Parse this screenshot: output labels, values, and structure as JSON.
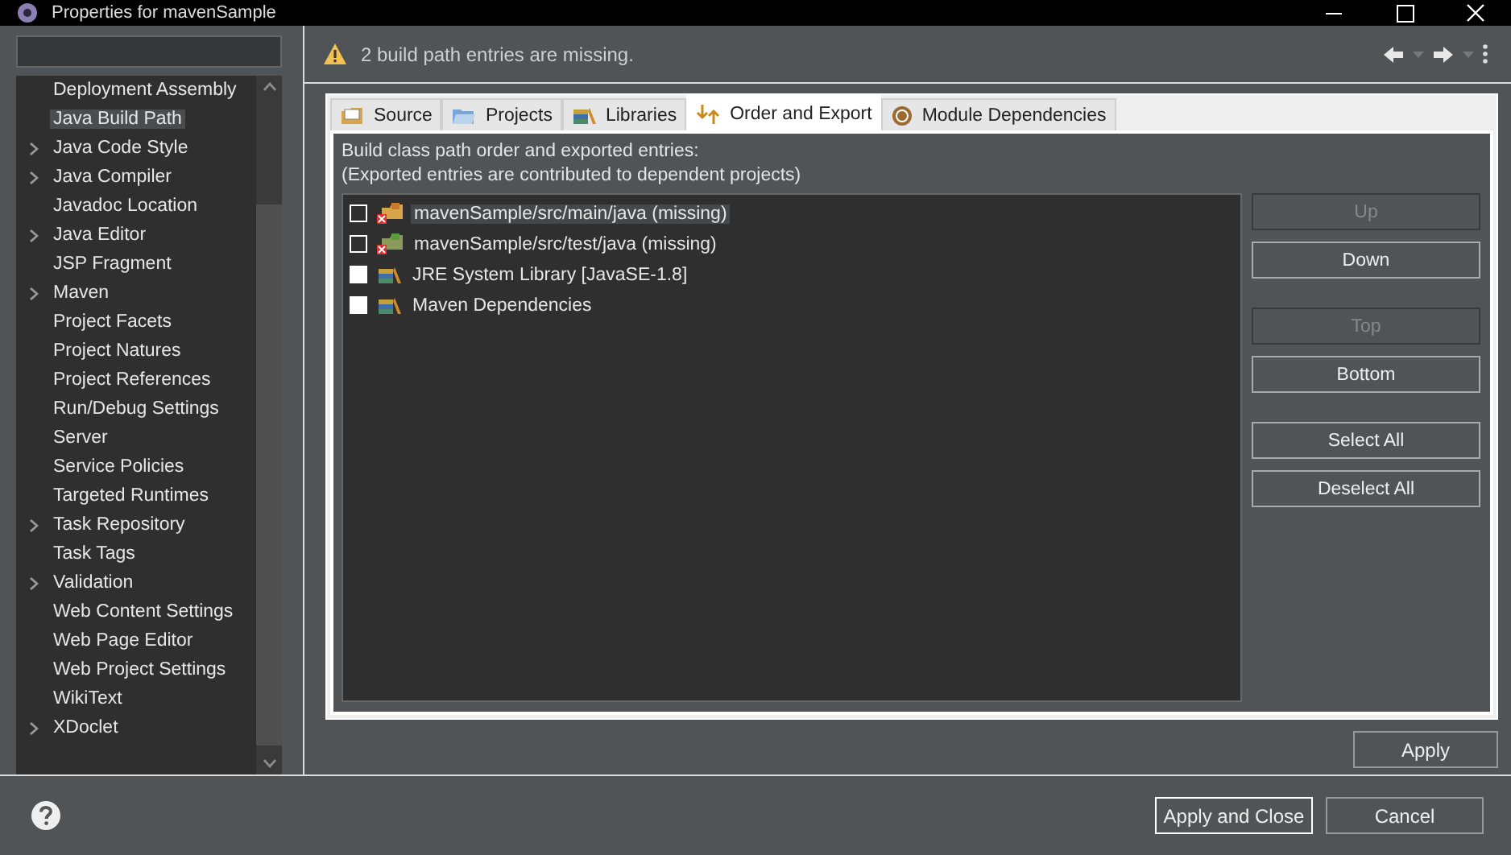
{
  "window": {
    "title": "Properties for mavenSample"
  },
  "sidebar": {
    "items": [
      {
        "label": "Deployment Assembly",
        "expandable": false,
        "selected": false
      },
      {
        "label": "Java Build Path",
        "expandable": false,
        "selected": true
      },
      {
        "label": "Java Code Style",
        "expandable": true,
        "selected": false
      },
      {
        "label": "Java Compiler",
        "expandable": true,
        "selected": false
      },
      {
        "label": "Javadoc Location",
        "expandable": false,
        "selected": false
      },
      {
        "label": "Java Editor",
        "expandable": true,
        "selected": false
      },
      {
        "label": "JSP Fragment",
        "expandable": false,
        "selected": false
      },
      {
        "label": "Maven",
        "expandable": true,
        "selected": false
      },
      {
        "label": "Project Facets",
        "expandable": false,
        "selected": false
      },
      {
        "label": "Project Natures",
        "expandable": false,
        "selected": false
      },
      {
        "label": "Project References",
        "expandable": false,
        "selected": false
      },
      {
        "label": "Run/Debug Settings",
        "expandable": false,
        "selected": false
      },
      {
        "label": "Server",
        "expandable": false,
        "selected": false
      },
      {
        "label": "Service Policies",
        "expandable": false,
        "selected": false
      },
      {
        "label": "Targeted Runtimes",
        "expandable": false,
        "selected": false
      },
      {
        "label": "Task Repository",
        "expandable": true,
        "selected": false
      },
      {
        "label": "Task Tags",
        "expandable": false,
        "selected": false
      },
      {
        "label": "Validation",
        "expandable": true,
        "selected": false
      },
      {
        "label": "Web Content Settings",
        "expandable": false,
        "selected": false
      },
      {
        "label": "Web Page Editor",
        "expandable": false,
        "selected": false
      },
      {
        "label": "Web Project Settings",
        "expandable": false,
        "selected": false
      },
      {
        "label": "WikiText",
        "expandable": false,
        "selected": false
      },
      {
        "label": "XDoclet",
        "expandable": true,
        "selected": false
      }
    ]
  },
  "message": "2 build path entries are missing.",
  "tabs": [
    {
      "label": "Source",
      "kind": "source",
      "selected": false
    },
    {
      "label": "Projects",
      "kind": "projects",
      "selected": false
    },
    {
      "label": "Libraries",
      "kind": "libraries",
      "selected": false
    },
    {
      "label": "Order and Export",
      "kind": "order",
      "selected": true
    },
    {
      "label": "Module Dependencies",
      "kind": "module",
      "selected": false
    }
  ],
  "description": [
    "Build class path order and exported entries:",
    "(Exported entries are contributed to dependent projects)"
  ],
  "entries": [
    {
      "label": "mavenSample/src/main/java (missing)",
      "kind": "missing-source",
      "disabled": true,
      "selected": true
    },
    {
      "label": "mavenSample/src/test/java (missing)",
      "kind": "missing-test",
      "disabled": true,
      "selected": false
    },
    {
      "label": "JRE System Library [JavaSE-1.8]",
      "kind": "library",
      "disabled": false,
      "selected": false
    },
    {
      "label": "Maven Dependencies",
      "kind": "library",
      "disabled": false,
      "selected": false
    }
  ],
  "side_button_groups": [
    [
      {
        "label": "Up",
        "disabled": true
      },
      {
        "label": "Down",
        "disabled": false
      }
    ],
    [
      {
        "label": "Top",
        "disabled": true
      },
      {
        "label": "Bottom",
        "disabled": false
      }
    ],
    [
      {
        "label": "Select All",
        "disabled": false
      },
      {
        "label": "Deselect All",
        "disabled": false
      }
    ]
  ],
  "apply": "Apply",
  "footer_buttons": [
    {
      "label": "Apply and Close",
      "default": true
    },
    {
      "label": "Cancel",
      "default": false
    }
  ]
}
